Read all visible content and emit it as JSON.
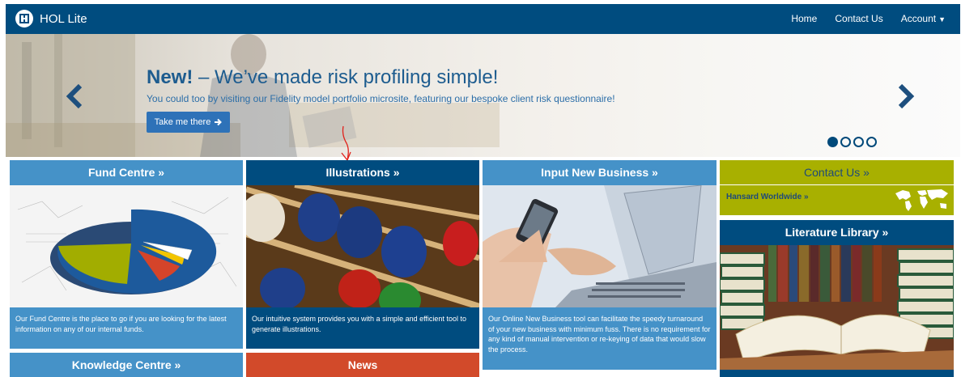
{
  "navbar": {
    "brand": "HOL Lite",
    "links": {
      "home": "Home",
      "contact": "Contact Us",
      "account": "Account"
    }
  },
  "hero": {
    "title_em": "New!",
    "title_rest": " – We’ve made risk profiling simple!",
    "subtitle": "You could too by visiting our Fidelity model portfolio microsite, featuring our bespoke client risk questionnaire!",
    "button": "Take me there"
  },
  "tiles": {
    "fund_centre": {
      "title": "Fund Centre »",
      "desc": "Our Fund Centre is the place to go if you are looking for the latest information on any of our internal funds."
    },
    "illustrations": {
      "title": "Illustrations »",
      "desc": "Our intuitive system provides you with a simple and efficient tool to generate illustrations."
    },
    "input_new_business": {
      "title": "Input New Business »",
      "desc": "Our Online New Business tool can facilitate the speedy turnaround of your new business with minimum fuss. There is no requirement for any kind of manual intervention or re-keying of data that would slow the process."
    },
    "contact_us": {
      "title": "Contact Us »",
      "link": "Hansard Worldwide »"
    },
    "literature_library": {
      "title": "Literature Library »"
    },
    "knowledge_centre": {
      "title": "Knowledge Centre »"
    },
    "news": {
      "title": "News"
    }
  },
  "colors": {
    "nav": "#004c7f",
    "light_blue": "#4592c8",
    "dark_blue": "#004c7f",
    "olive": "#a8b000",
    "news": "#d24a2a"
  }
}
